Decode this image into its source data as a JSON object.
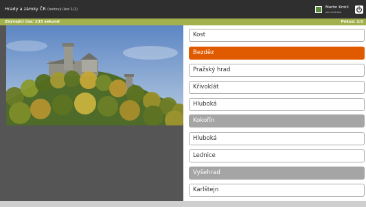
{
  "header": {
    "title": "Hrady a zámky ČR",
    "subtitle": "(testový úkol 1/1)",
    "user_name": "Martin Krotil",
    "user_role": "administrátor"
  },
  "status": {
    "time_left": "Zbývající čas: 233 sekund",
    "attempts": "Pokus: 2/2"
  },
  "icons": {
    "power": "power-icon",
    "avatar": "user-avatar-icon"
  },
  "colors": {
    "topbar": "#2f2f2f",
    "status_bar": "#a2b14e",
    "selected": "#e05a00",
    "disabled": "#a5a5a5"
  },
  "answers": [
    {
      "label": "Kost",
      "state": "normal"
    },
    {
      "label": "Bezděz",
      "state": "selected"
    },
    {
      "label": "Pražský hrad",
      "state": "normal"
    },
    {
      "label": "Křivoklát",
      "state": "normal"
    },
    {
      "label": "Hluboká",
      "state": "normal"
    },
    {
      "label": "Kokořín",
      "state": "disabled"
    },
    {
      "label": "Hluboká",
      "state": "normal"
    },
    {
      "label": "Lednice",
      "state": "normal"
    },
    {
      "label": "Vyšehrad",
      "state": "disabled"
    },
    {
      "label": "Karlštejn",
      "state": "normal"
    }
  ]
}
